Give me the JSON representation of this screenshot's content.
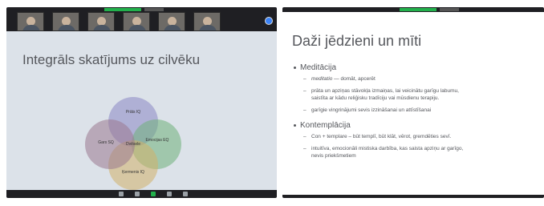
{
  "left": {
    "title": "Integrāls skatījums uz cilvēku",
    "venn": {
      "top": "Prāts IQ",
      "right": "Emocijas EQ",
      "bottom": "Ķermenis IQ",
      "left": "Gars SQ",
      "center": "Dvēsele"
    },
    "colors": {
      "top": "#8a86c4",
      "right": "#6fb07a",
      "bottom": "#d1b06a",
      "left": "#9a7890"
    }
  },
  "right": {
    "title": "Daži jēdzieni un mīti",
    "sections": [
      {
        "label": "Meditācija",
        "items": [
          {
            "term": "meditatio",
            "text": " — domāt, apcerēt"
          },
          {
            "term": "",
            "text": "prāta un apziņas stāvokļa izmaiņas, lai veicinātu garīgu labumu,"
          },
          {
            "term": "",
            "text": "saistīta ar kādu reliģisku tradīciju vai mūsdienu terapiju."
          },
          {
            "term": "",
            "text": "garīgie vingrinājumi sevis izzināšanai un attīstīšanai"
          }
        ]
      },
      {
        "label": "Kontemplācija",
        "items": [
          {
            "term": "",
            "text": "Con + templare – būt templī, būt klāt, vērot, gremdēties sevī."
          },
          {
            "term": "",
            "text": "intuitīva, emocionāli mistiska darbība, kas saista apziņu ar garīgo,"
          },
          {
            "term": "",
            "text": "nevis priekšmetiem"
          }
        ]
      }
    ]
  },
  "icons": {
    "expand": "expand-icon",
    "participants": "people-icon",
    "chat": "chat-icon",
    "share": "share-screen-icon",
    "react": "react-icon",
    "leave": "leave-icon"
  }
}
